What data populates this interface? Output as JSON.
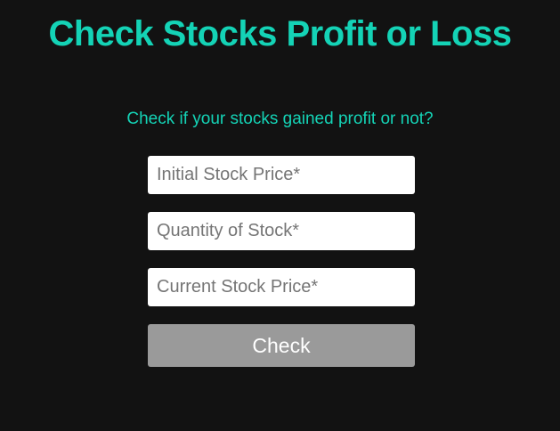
{
  "header": {
    "title": "Check Stocks Profit or Loss",
    "subtitle": "Check if your stocks gained profit or not?"
  },
  "form": {
    "initial_price": {
      "value": "",
      "placeholder": "Initial Stock Price*"
    },
    "quantity": {
      "value": "",
      "placeholder": "Quantity of Stock*"
    },
    "current_price": {
      "value": "",
      "placeholder": "Current Stock Price*"
    },
    "check_label": "Check"
  },
  "colors": {
    "background": "#121212",
    "accent": "#14d3b6",
    "button": "#9a9a9a"
  }
}
